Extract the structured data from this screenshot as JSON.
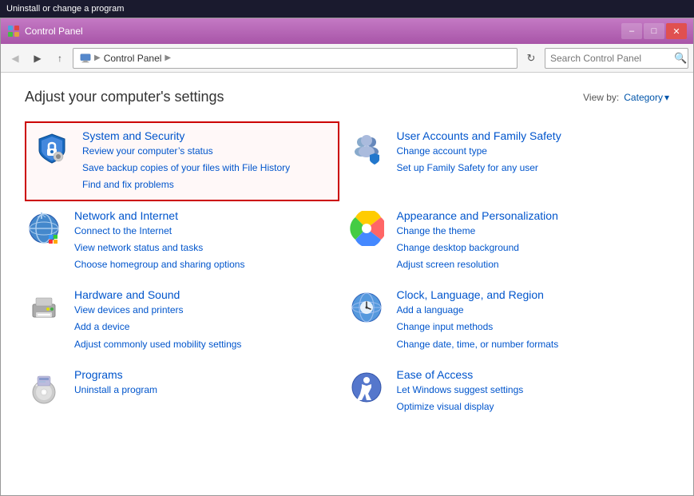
{
  "taskbar": {
    "label": "Uninstall or change a program"
  },
  "window": {
    "title": "Control Panel"
  },
  "titlebar": {
    "title": "Control Panel",
    "minimize_label": "–",
    "maximize_label": "□",
    "close_label": "✕"
  },
  "addressbar": {
    "back_icon": "◀",
    "forward_icon": "▶",
    "up_icon": "↑",
    "path_icon": "🖥",
    "path_segment": "Control Panel",
    "path_arrow": "▶",
    "refresh_icon": "↻",
    "search_placeholder": "Search Control Panel",
    "search_icon": "🔍"
  },
  "header": {
    "title": "Adjust your computer's settings",
    "viewby_label": "View by:",
    "viewby_value": "Category",
    "viewby_arrow": "▾"
  },
  "categories": [
    {
      "id": "system-security",
      "name": "System and Security",
      "highlighted": true,
      "links": [
        "Review your computer's status",
        "Save backup copies of your files with File History",
        "Find and fix problems"
      ]
    },
    {
      "id": "user-accounts",
      "name": "User Accounts and Family Safety",
      "highlighted": false,
      "links": [
        "Change account type",
        "Set up Family Safety for any user"
      ]
    },
    {
      "id": "network-internet",
      "name": "Network and Internet",
      "highlighted": false,
      "links": [
        "Connect to the Internet",
        "View network status and tasks",
        "Choose homegroup and sharing options"
      ]
    },
    {
      "id": "appearance",
      "name": "Appearance and Personalization",
      "highlighted": false,
      "links": [
        "Change the theme",
        "Change desktop background",
        "Adjust screen resolution"
      ]
    },
    {
      "id": "hardware-sound",
      "name": "Hardware and Sound",
      "highlighted": false,
      "links": [
        "View devices and printers",
        "Add a device",
        "Adjust commonly used mobility settings"
      ]
    },
    {
      "id": "clock-language",
      "name": "Clock, Language, and Region",
      "highlighted": false,
      "links": [
        "Add a language",
        "Change input methods",
        "Change date, time, or number formats"
      ]
    },
    {
      "id": "programs",
      "name": "Programs",
      "highlighted": false,
      "links": [
        "Uninstall a program"
      ]
    },
    {
      "id": "ease-access",
      "name": "Ease of Access",
      "highlighted": false,
      "links": [
        "Let Windows suggest settings",
        "Optimize visual display"
      ]
    }
  ]
}
